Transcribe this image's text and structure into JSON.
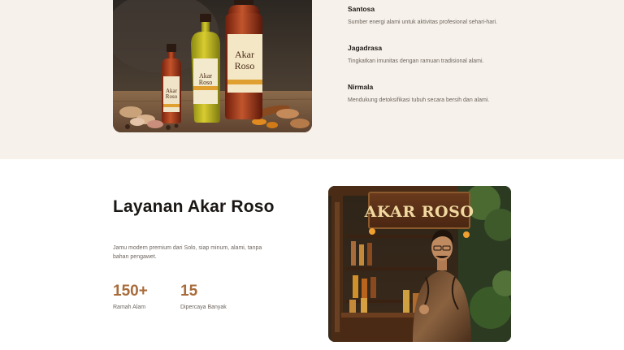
{
  "benefits": [
    {
      "title": "Santosa",
      "description": "Sumber energi alami untuk aktivitas profesional sehari-hari."
    },
    {
      "title": "Jagadrasa",
      "description": "Tingkatkan imunitas dengan ramuan tradisional alami."
    },
    {
      "title": "Nirmala",
      "description": "Mendukung detoksifikasi tubuh secara bersih dan alami."
    }
  ],
  "product_image": {
    "bottle_label": "Akar Roso"
  },
  "service": {
    "title": "Layanan Akar Roso",
    "description": "Jamu modern premium dari Solo, siap minum, alami, tanpa bahan pengawet."
  },
  "stats": [
    {
      "value": "150+",
      "label": "Ramah Alam"
    },
    {
      "value": "15",
      "label": "Dipercaya Banyak"
    }
  ],
  "shop_image": {
    "sign_text": "AKAR ROSO"
  },
  "colors": {
    "accent": "#a86b3a",
    "section_bg": "#f6f1ea"
  }
}
